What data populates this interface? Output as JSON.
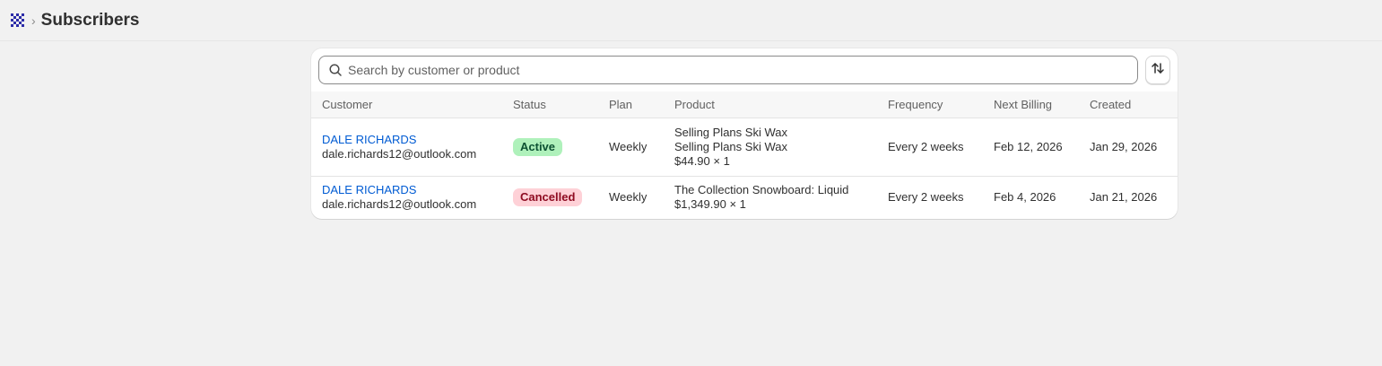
{
  "header": {
    "breadcrumb_separator": "›",
    "title": "Subscribers"
  },
  "search": {
    "placeholder": "Search by customer or product",
    "value": ""
  },
  "table": {
    "columns": [
      "Customer",
      "Status",
      "Plan",
      "Product",
      "Frequency",
      "Next Billing",
      "Created"
    ],
    "rows": [
      {
        "customer_name": "DALE RICHARDS",
        "customer_email": "dale.richards12@outlook.com",
        "status": "Active",
        "plan": "Weekly",
        "product_lines": [
          "Selling Plans Ski Wax",
          "Selling Plans Ski Wax",
          "$44.90 × 1"
        ],
        "frequency": "Every 2 weeks",
        "next_billing": "Feb 12, 2026",
        "created": "Jan 29, 2026"
      },
      {
        "customer_name": "DALE RICHARDS",
        "customer_email": "dale.richards12@outlook.com",
        "status": "Cancelled",
        "plan": "Weekly",
        "product_lines": [
          "The Collection Snowboard: Liquid",
          "$1,349.90 × 1"
        ],
        "frequency": "Every 2 weeks",
        "next_billing": "Feb 4, 2026",
        "created": "Jan 21, 2026"
      }
    ]
  },
  "colors": {
    "link": "#005bd3",
    "active_badge_bg": "#aff1bb",
    "cancelled_badge_bg": "#fed1d7",
    "app_icon": "#2c2ca8"
  },
  "icons": {
    "app": "grid-app-icon",
    "search": "search-icon",
    "sort": "sort-arrows-icon"
  }
}
